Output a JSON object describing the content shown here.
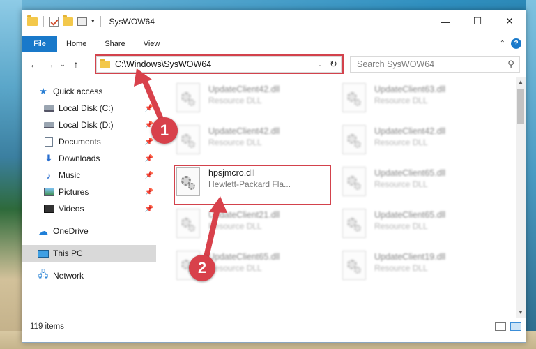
{
  "window": {
    "title": "SysWOW64",
    "controls": {
      "minimize": "—",
      "maximize": "☐",
      "close": "✕"
    }
  },
  "ribbon": {
    "tabs": [
      "File",
      "Home",
      "Share",
      "View"
    ],
    "help": "?",
    "collapse": "⌃"
  },
  "nav": {
    "back": "←",
    "forward": "→",
    "recent": "⌄",
    "up": "↑",
    "address": "C:\\Windows\\SysWOW64",
    "address_dropdown": "⌄",
    "refresh": "↻",
    "search_placeholder": "Search SysWOW64",
    "search_icon": "⚲"
  },
  "sidebar": {
    "items": [
      {
        "label": "Quick access",
        "icon": "star-icon"
      },
      {
        "label": "Local Disk (C:)",
        "icon": "drive-icon",
        "pinned": true
      },
      {
        "label": "Local Disk (D:)",
        "icon": "drive-icon",
        "pinned": true
      },
      {
        "label": "Documents",
        "icon": "document-icon",
        "pinned": true
      },
      {
        "label": "Downloads",
        "icon": "download-icon",
        "pinned": true
      },
      {
        "label": "Music",
        "icon": "music-icon",
        "pinned": true
      },
      {
        "label": "Pictures",
        "icon": "pictures-icon",
        "pinned": true
      },
      {
        "label": "Videos",
        "icon": "videos-icon",
        "pinned": true
      },
      {
        "label": "OneDrive",
        "icon": "cloud-icon"
      },
      {
        "label": "This PC",
        "icon": "computer-icon"
      },
      {
        "label": "Network",
        "icon": "network-icon"
      }
    ],
    "pin_glyph": "📌"
  },
  "files": {
    "left": [
      {
        "name": "UpdateClient42.dll",
        "type": "Resource DLL"
      },
      {
        "name": "UpdateClient42.dll",
        "type": "Resource DLL"
      },
      {
        "name": "hpsjmcro.dll",
        "type": "Hewlett-Packard Fla..."
      },
      {
        "name": "UpdateClient21.dll",
        "type": "Resource DLL"
      },
      {
        "name": "UpdateClient65.dll",
        "type": "Resource DLL"
      }
    ],
    "right": [
      {
        "name": "UpdateClient63.dll",
        "type": "Resource DLL"
      },
      {
        "name": "UpdateClient42.dll",
        "type": "Resource DLL"
      },
      {
        "name": "UpdateClient65.dll",
        "type": "Resource DLL"
      },
      {
        "name": "UpdateClient65.dll",
        "type": "Resource DLL"
      },
      {
        "name": "UpdateClient19.dll",
        "type": "Resource DLL"
      }
    ]
  },
  "status": {
    "item_count": "119 items"
  },
  "annotations": {
    "callout_1": "1",
    "callout_2": "2",
    "accent_color": "#d8414b"
  }
}
